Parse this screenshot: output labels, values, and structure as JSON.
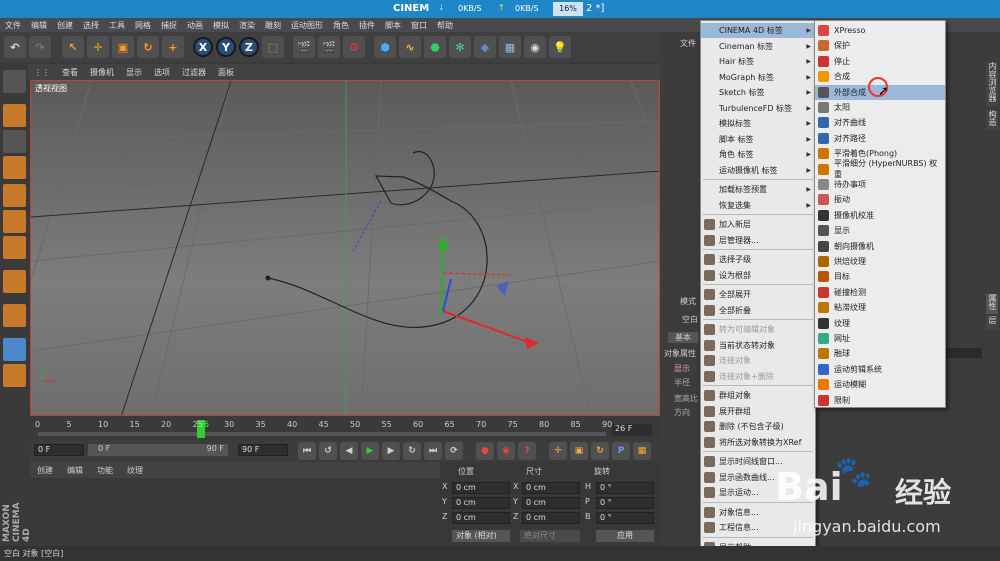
{
  "titlebar": {
    "app_title": "CINEM",
    "down_rate": "0KB/S",
    "up_rate": "0KB/S",
    "percent": "16%",
    "doc_suffix": "2 *]"
  },
  "menubar": [
    "文件",
    "编辑",
    "创建",
    "选择",
    "工具",
    "网格",
    "捕捉",
    "动画",
    "模拟",
    "渲染",
    "雕刻",
    "运动图形",
    "角色",
    "插件",
    "脚本",
    "窗口",
    "帮助"
  ],
  "viewport": {
    "menu": [
      "查看",
      "摄像机",
      "显示",
      "选项",
      "过滤器",
      "面板"
    ],
    "label": "透视视图"
  },
  "timeline": {
    "ticks": [
      "0",
      "5",
      "10",
      "15",
      "20",
      "25",
      "26",
      "30",
      "35",
      "40",
      "45",
      "50",
      "55",
      "60",
      "65",
      "70",
      "75",
      "80",
      "85",
      "90"
    ],
    "current_frame": "26 F"
  },
  "playbar": {
    "start": "0 F",
    "field": "0 F",
    "end_field": "90 F",
    "end": "90 F"
  },
  "bottom_left": {
    "menu": [
      "创建",
      "编辑",
      "功能",
      "纹理"
    ],
    "brand1": "MAXON",
    "brand2": "CINEMA 4D"
  },
  "coords": {
    "headers": [
      "位置",
      "尺寸",
      "旋转"
    ],
    "rows": [
      {
        "a": "X",
        "av": "0 cm",
        "b": "X",
        "bv": "0 cm",
        "c": "H",
        "cv": "0 °"
      },
      {
        "a": "Y",
        "av": "0 cm",
        "b": "Y",
        "bv": "0 cm",
        "c": "P",
        "cv": "0 °"
      },
      {
        "a": "Z",
        "av": "0 cm",
        "b": "Z",
        "bv": "0 cm",
        "c": "B",
        "cv": "0 °"
      }
    ],
    "mode": "对象 (相对)",
    "size_mode": "绝对尺寸",
    "apply": "应用"
  },
  "right_panel": {
    "file": "文件",
    "mode_label": "模式",
    "attr_title": "空白",
    "basic": "基本",
    "coord": "坐",
    "obj_props": "对象属性",
    "show": "显示",
    "radius": "半径",
    "ratio": "宽高比",
    "direction": "方向",
    "side_tab": "属性",
    "side_tab2": "层",
    "side_tab3": "内容浏览器",
    "side_tab4": "构造"
  },
  "menu1": {
    "items": [
      {
        "label": "CINEMA 4D 标签",
        "sub": true,
        "hl": true
      },
      {
        "label": "Cineman 标签",
        "sub": true
      },
      {
        "label": "Hair 标签",
        "sub": true
      },
      {
        "label": "MoGraph 标签",
        "sub": true
      },
      {
        "label": "Sketch 标签",
        "sub": true
      },
      {
        "label": "TurbulenceFD 标签",
        "sub": true
      },
      {
        "label": "模拟标签",
        "sub": true
      },
      {
        "label": "脚本 标签",
        "sub": true
      },
      {
        "label": "角色 标签",
        "sub": true
      },
      {
        "label": "运动摄像机 标签",
        "sub": true
      },
      {
        "label": "加载标签预置",
        "sub": true,
        "sep": true
      },
      {
        "label": "恢复选集",
        "sub": true
      },
      {
        "label": "加入新层",
        "sep": true
      },
      {
        "label": "层管理器..."
      },
      {
        "label": "选择子级",
        "sep": true
      },
      {
        "label": "设为根部"
      },
      {
        "label": "全部展开",
        "sep": true
      },
      {
        "label": "全部折叠"
      },
      {
        "label": "转为可编辑对象",
        "dis": true,
        "sep": true
      },
      {
        "label": "当前状态转对象"
      },
      {
        "label": "连接对象",
        "dis": true
      },
      {
        "label": "连接对象+删除",
        "dis": true
      },
      {
        "label": "群组对象",
        "sep": true
      },
      {
        "label": "展开群组"
      },
      {
        "label": "删除 (不包含子级)"
      },
      {
        "label": "将所选对象转换为XRef"
      },
      {
        "label": "显示时间线窗口...",
        "sep": true
      },
      {
        "label": "显示函数曲线..."
      },
      {
        "label": "显示运动..."
      },
      {
        "label": "对象信息...",
        "sep": true
      },
      {
        "label": "工程信息..."
      },
      {
        "label": "显示帮助...",
        "sep": true
      }
    ]
  },
  "menu2": {
    "items": [
      {
        "label": "XPresso",
        "color": "#d44"
      },
      {
        "label": "保护",
        "color": "#c63"
      },
      {
        "label": "停止",
        "color": "#c33"
      },
      {
        "label": "合成",
        "color": "#e90"
      },
      {
        "label": "外部合成",
        "color": "#555",
        "hl": true
      },
      {
        "label": "太阳",
        "color": "#777"
      },
      {
        "label": "对齐曲线",
        "color": "#36a"
      },
      {
        "label": "对齐路径",
        "color": "#36a"
      },
      {
        "label": "平滑着色(Phong)",
        "color": "#c70"
      },
      {
        "label": "平滑细分 (HyperNURBS) 权重",
        "color": "#c70"
      },
      {
        "label": "待办事项",
        "color": "#888"
      },
      {
        "label": "振动",
        "color": "#c55"
      },
      {
        "label": "摄像机校准",
        "color": "#333"
      },
      {
        "label": "显示",
        "color": "#555"
      },
      {
        "label": "朝向摄像机",
        "color": "#444"
      },
      {
        "label": "烘焙纹理",
        "color": "#a60"
      },
      {
        "label": "目标",
        "color": "#b50"
      },
      {
        "label": "碰撞检测",
        "color": "#c33"
      },
      {
        "label": "粘滞纹理",
        "color": "#b70"
      },
      {
        "label": "纹理",
        "color": "#333"
      },
      {
        "label": "网址",
        "color": "#3a8"
      },
      {
        "label": "融球",
        "color": "#b70"
      },
      {
        "label": "运动剪辑系统",
        "color": "#36c"
      },
      {
        "label": "运动模糊",
        "color": "#e70"
      },
      {
        "label": "限制",
        "color": "#c33"
      }
    ]
  },
  "status": "空白 对象 [空白]",
  "watermark": {
    "brand": "Bai",
    "brand_cn": "经验",
    "url": "jingyan.baidu.com"
  }
}
